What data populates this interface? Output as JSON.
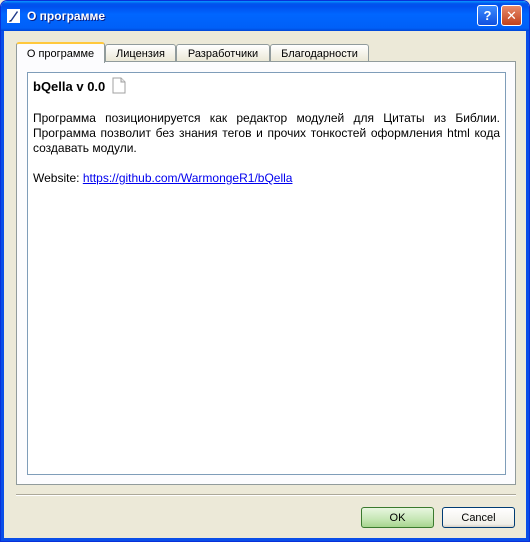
{
  "window": {
    "title": "О программе",
    "help_symbol": "?",
    "close_symbol": "✕"
  },
  "tabs": [
    {
      "label": "О программе",
      "active": true
    },
    {
      "label": "Лицензия",
      "active": false
    },
    {
      "label": "Разработчики",
      "active": false
    },
    {
      "label": "Благодарности",
      "active": false
    }
  ],
  "about": {
    "app_title": "bQella v 0.0",
    "description": "Программа позиционируется как редактор модулей для Цитаты из Библии. Программа позволит без знания тегов и прочих тонкостей оформления html кода создавать модули.",
    "website_label": "Website:",
    "website_url": "https://github.com/WarmongeR1/bQella"
  },
  "buttons": {
    "ok": "OK",
    "cancel": "Cancel"
  },
  "icons": {
    "title_icon": "quill-icon",
    "doc_icon": "document-icon"
  }
}
